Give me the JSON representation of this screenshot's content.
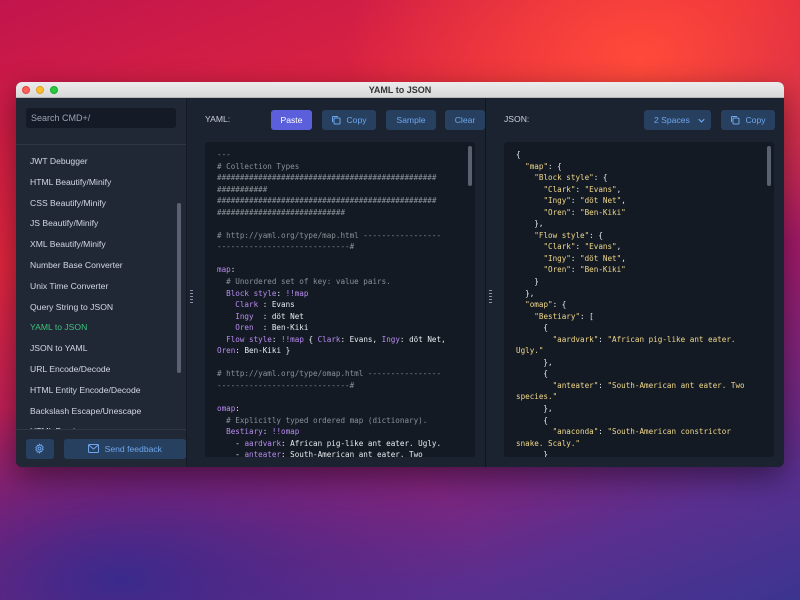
{
  "window": {
    "title": "YAML to JSON"
  },
  "sidebar": {
    "search_placeholder": "Search CMD+/",
    "items": [
      {
        "label": "JWT Debugger"
      },
      {
        "label": "HTML Beautify/Minify"
      },
      {
        "label": "CSS Beautify/Minify"
      },
      {
        "label": "JS Beautify/Minify"
      },
      {
        "label": "XML Beautify/Minify"
      },
      {
        "label": "Number Base Converter"
      },
      {
        "label": "Unix Time Converter"
      },
      {
        "label": "Query String to JSON"
      },
      {
        "label": "YAML to JSON"
      },
      {
        "label": "JSON to YAML"
      },
      {
        "label": "URL Encode/Decode"
      },
      {
        "label": "HTML Entity Encode/Decode"
      },
      {
        "label": "Backslash Escape/Unescape"
      },
      {
        "label": "HTML Preview"
      }
    ],
    "active_item": "YAML to JSON",
    "feedback_label": "Send feedback",
    "settings_icon": "gear-icon"
  },
  "input_pane": {
    "label": "YAML:",
    "paste_label": "Paste",
    "copy_label": "Copy",
    "sample_label": "Sample",
    "clear_label": "Clear",
    "lines": [
      [
        [
          "c-com",
          "---"
        ]
      ],
      [
        [
          "c-com",
          "# Collection Types"
        ]
      ],
      [
        [
          "c-com",
          "################################################"
        ]
      ],
      [
        [
          "c-com",
          "###########"
        ]
      ],
      [
        [
          "c-com",
          "################################################"
        ]
      ],
      [
        [
          "c-com",
          "############################"
        ]
      ],
      [
        [
          "c-com",
          ""
        ]
      ],
      [
        [
          "c-com",
          "# http://yaml.org/type/map.html -----------------"
        ]
      ],
      [
        [
          "c-com",
          "-----------------------------#"
        ]
      ],
      [
        [
          "c-com",
          ""
        ]
      ],
      [
        [
          "c-key",
          "map"
        ],
        [
          "c-val",
          ":"
        ]
      ],
      [
        [
          "c-com",
          "  # Unordered set of key: value pairs."
        ]
      ],
      [
        [
          "c-key",
          "  Block style"
        ],
        [
          "c-val",
          ": "
        ],
        [
          "c-tag",
          "!!map"
        ]
      ],
      [
        [
          "c-key",
          "    Clark "
        ],
        [
          "c-val",
          ": Evans"
        ]
      ],
      [
        [
          "c-key",
          "    Ingy  "
        ],
        [
          "c-val",
          ": döt Net"
        ]
      ],
      [
        [
          "c-key",
          "    Oren  "
        ],
        [
          "c-val",
          ": Ben-Kiki"
        ]
      ],
      [
        [
          "c-key",
          "  Flow style"
        ],
        [
          "c-val",
          ": "
        ],
        [
          "c-tag",
          "!!map"
        ],
        [
          "c-val",
          " { "
        ],
        [
          "c-key",
          "Clark"
        ],
        [
          "c-val",
          ": Evans, "
        ],
        [
          "c-key",
          "Ingy"
        ],
        [
          "c-val",
          ": döt Net,"
        ]
      ],
      [
        [
          "c-key",
          "Oren"
        ],
        [
          "c-val",
          ": Ben-Kiki }"
        ]
      ],
      [
        [
          "c-com",
          ""
        ]
      ],
      [
        [
          "c-com",
          "# http://yaml.org/type/omap.html ----------------"
        ]
      ],
      [
        [
          "c-com",
          "-----------------------------#"
        ]
      ],
      [
        [
          "c-com",
          ""
        ]
      ],
      [
        [
          "c-key",
          "omap"
        ],
        [
          "c-val",
          ":"
        ]
      ],
      [
        [
          "c-com",
          "  # Explicitly typed ordered map (dictionary)."
        ]
      ],
      [
        [
          "c-key",
          "  Bestiary"
        ],
        [
          "c-val",
          ": "
        ],
        [
          "c-tag",
          "!!omap"
        ]
      ],
      [
        [
          "c-val",
          "    - "
        ],
        [
          "c-key",
          "aardvark"
        ],
        [
          "c-val",
          ": African pig-like ant eater. Ugly."
        ]
      ],
      [
        [
          "c-val",
          "    - "
        ],
        [
          "c-key",
          "anteater"
        ],
        [
          "c-val",
          ": South-American ant eater. Two"
        ]
      ]
    ]
  },
  "output_pane": {
    "label": "JSON:",
    "indent_select": "2 Spaces",
    "copy_label": "Copy",
    "lines": [
      [
        [
          "c-p",
          "{"
        ]
      ],
      [
        [
          "c-p",
          "  "
        ],
        [
          "c-jkey",
          "\"map\""
        ],
        [
          "c-p",
          ": {"
        ]
      ],
      [
        [
          "c-p",
          "    "
        ],
        [
          "c-jkey",
          "\"Block style\""
        ],
        [
          "c-p",
          ": {"
        ]
      ],
      [
        [
          "c-p",
          "      "
        ],
        [
          "c-jkey",
          "\"Clark\""
        ],
        [
          "c-p",
          ": "
        ],
        [
          "c-str",
          "\"Evans\""
        ],
        [
          "c-p",
          ","
        ]
      ],
      [
        [
          "c-p",
          "      "
        ],
        [
          "c-jkey",
          "\"Ingy\""
        ],
        [
          "c-p",
          ": "
        ],
        [
          "c-str",
          "\"döt Net\""
        ],
        [
          "c-p",
          ","
        ]
      ],
      [
        [
          "c-p",
          "      "
        ],
        [
          "c-jkey",
          "\"Oren\""
        ],
        [
          "c-p",
          ": "
        ],
        [
          "c-str",
          "\"Ben-Kiki\""
        ]
      ],
      [
        [
          "c-p",
          "    },"
        ]
      ],
      [
        [
          "c-p",
          "    "
        ],
        [
          "c-jkey",
          "\"Flow style\""
        ],
        [
          "c-p",
          ": {"
        ]
      ],
      [
        [
          "c-p",
          "      "
        ],
        [
          "c-jkey",
          "\"Clark\""
        ],
        [
          "c-p",
          ": "
        ],
        [
          "c-str",
          "\"Evans\""
        ],
        [
          "c-p",
          ","
        ]
      ],
      [
        [
          "c-p",
          "      "
        ],
        [
          "c-jkey",
          "\"Ingy\""
        ],
        [
          "c-p",
          ": "
        ],
        [
          "c-str",
          "\"döt Net\""
        ],
        [
          "c-p",
          ","
        ]
      ],
      [
        [
          "c-p",
          "      "
        ],
        [
          "c-jkey",
          "\"Oren\""
        ],
        [
          "c-p",
          ": "
        ],
        [
          "c-str",
          "\"Ben-Kiki\""
        ]
      ],
      [
        [
          "c-p",
          "    }"
        ]
      ],
      [
        [
          "c-p",
          "  },"
        ]
      ],
      [
        [
          "c-p",
          "  "
        ],
        [
          "c-jkey",
          "\"omap\""
        ],
        [
          "c-p",
          ": {"
        ]
      ],
      [
        [
          "c-p",
          "    "
        ],
        [
          "c-jkey",
          "\"Bestiary\""
        ],
        [
          "c-p",
          ": ["
        ]
      ],
      [
        [
          "c-p",
          "      {"
        ]
      ],
      [
        [
          "c-p",
          "        "
        ],
        [
          "c-jkey",
          "\"aardvark\""
        ],
        [
          "c-p",
          ": "
        ],
        [
          "c-str",
          "\"African pig-like ant eater."
        ]
      ],
      [
        [
          "c-str",
          "Ugly.\""
        ]
      ],
      [
        [
          "c-p",
          "      },"
        ]
      ],
      [
        [
          "c-p",
          "      {"
        ]
      ],
      [
        [
          "c-p",
          "        "
        ],
        [
          "c-jkey",
          "\"anteater\""
        ],
        [
          "c-p",
          ": "
        ],
        [
          "c-str",
          "\"South-American ant eater. Two"
        ]
      ],
      [
        [
          "c-str",
          "species.\""
        ]
      ],
      [
        [
          "c-p",
          "      },"
        ]
      ],
      [
        [
          "c-p",
          "      {"
        ]
      ],
      [
        [
          "c-p",
          "        "
        ],
        [
          "c-jkey",
          "\"anaconda\""
        ],
        [
          "c-p",
          ": "
        ],
        [
          "c-str",
          "\"South-American constrictor"
        ]
      ],
      [
        [
          "c-str",
          "snake. Scaly.\""
        ]
      ],
      [
        [
          "c-p",
          "      }"
        ]
      ]
    ]
  },
  "colors": {
    "accent": "#5b5fdb",
    "active_item": "#3fc07a",
    "secondary_button": "#28405f",
    "secondary_text": "#6ea6ee"
  }
}
